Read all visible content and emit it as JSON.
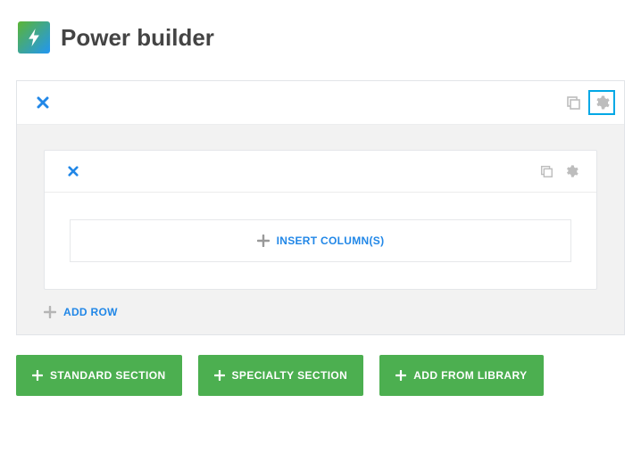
{
  "header": {
    "title": "Power builder"
  },
  "section": {
    "row": {
      "insert_columns_label": "INSERT COLUMN(S)"
    },
    "add_row_label": "ADD ROW"
  },
  "buttons": {
    "standard_section": "STANDARD SECTION",
    "specialty_section": "SPECIALTY SECTION",
    "add_from_library": "ADD FROM LIBRARY"
  }
}
